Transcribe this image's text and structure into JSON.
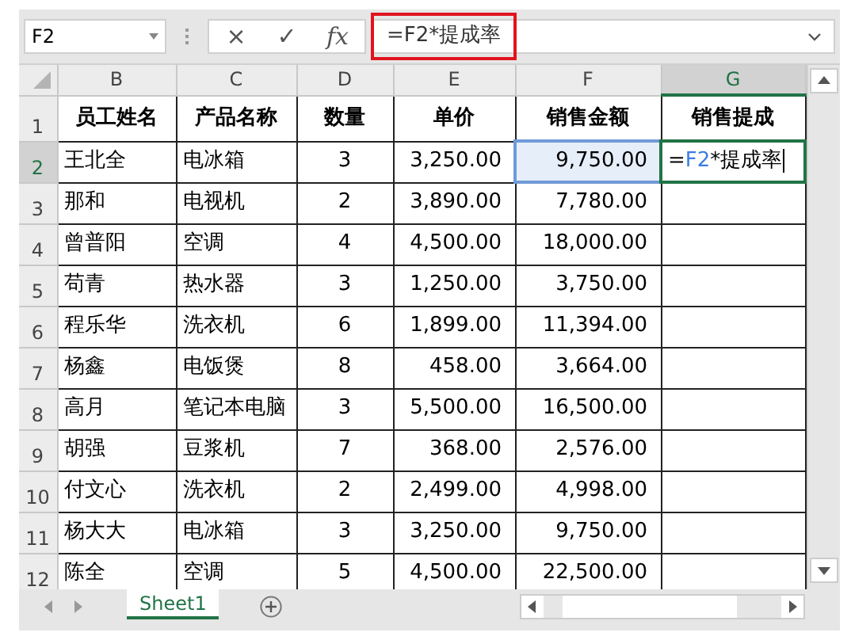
{
  "name_box": {
    "value": "F2"
  },
  "formula_bar": {
    "value": "=F2*提成率",
    "highlighted": true
  },
  "formula_buttons": [
    "×",
    "✓",
    "fx"
  ],
  "columns": [
    {
      "label": "B",
      "selected": false
    },
    {
      "label": "C",
      "selected": false
    },
    {
      "label": "D",
      "selected": false
    },
    {
      "label": "E",
      "selected": false
    },
    {
      "label": "F",
      "selected": false
    },
    {
      "label": "G",
      "selected": true
    }
  ],
  "rows": [
    {
      "label": "1",
      "selected": false,
      "kind": "header",
      "cells": [
        "员工姓名",
        "产品名称",
        "数量",
        "单价",
        "销售金额",
        "销售提成"
      ]
    },
    {
      "label": "2",
      "selected": true,
      "kind": "data",
      "cells": [
        {
          "text": "王北全",
          "referenced": false,
          "editing": false
        },
        {
          "text": "电冰箱",
          "referenced": false,
          "editing": false
        },
        {
          "text": "3",
          "referenced": false,
          "editing": false
        },
        {
          "text": "3,250.00",
          "referenced": false,
          "editing": false
        },
        {
          "text": "9,750.00",
          "referenced": true,
          "editing": false
        },
        {
          "parts": [
            {
              "text": "=",
              "kind": "plain"
            },
            {
              "text": "F2",
              "kind": "ref"
            },
            {
              "text": "*提成率",
              "kind": "plain"
            }
          ],
          "referenced": false,
          "editing": true
        }
      ]
    },
    {
      "label": "3",
      "selected": false,
      "kind": "data",
      "cells": [
        "那和",
        "电视机",
        "2",
        "3,890.00",
        "7,780.00",
        ""
      ]
    },
    {
      "label": "4",
      "selected": false,
      "kind": "data",
      "cells": [
        "曾普阳",
        "空调",
        "4",
        "4,500.00",
        "18,000.00",
        ""
      ]
    },
    {
      "label": "5",
      "selected": false,
      "kind": "data",
      "cells": [
        "苟青",
        "热水器",
        "3",
        "1,250.00",
        "3,750.00",
        ""
      ]
    },
    {
      "label": "6",
      "selected": false,
      "kind": "data",
      "cells": [
        "程乐华",
        "洗衣机",
        "6",
        "1,899.00",
        "11,394.00",
        ""
      ]
    },
    {
      "label": "7",
      "selected": false,
      "kind": "data",
      "cells": [
        "杨鑫",
        "电饭煲",
        "8",
        "458.00",
        "3,664.00",
        ""
      ]
    },
    {
      "label": "8",
      "selected": false,
      "kind": "data",
      "cells": [
        "高月",
        "笔记本电脑",
        "3",
        "5,500.00",
        "16,500.00",
        ""
      ]
    },
    {
      "label": "9",
      "selected": false,
      "kind": "data",
      "cells": [
        "胡强",
        "豆浆机",
        "7",
        "368.00",
        "2,576.00",
        ""
      ]
    },
    {
      "label": "10",
      "selected": false,
      "kind": "data",
      "cells": [
        "付文心",
        "洗衣机",
        "2",
        "2,499.00",
        "4,998.00",
        ""
      ]
    },
    {
      "label": "11",
      "selected": false,
      "kind": "data",
      "cells": [
        "杨大大",
        "电冰箱",
        "3",
        "3,250.00",
        "9,750.00",
        ""
      ]
    },
    {
      "label": "12",
      "selected": false,
      "kind": "data",
      "cells": [
        "陈全",
        "空调",
        "5",
        "4,500.00",
        "22,500.00",
        ""
      ]
    }
  ],
  "sheet_tabs": [
    {
      "label": "Sheet1",
      "selected": true
    }
  ]
}
